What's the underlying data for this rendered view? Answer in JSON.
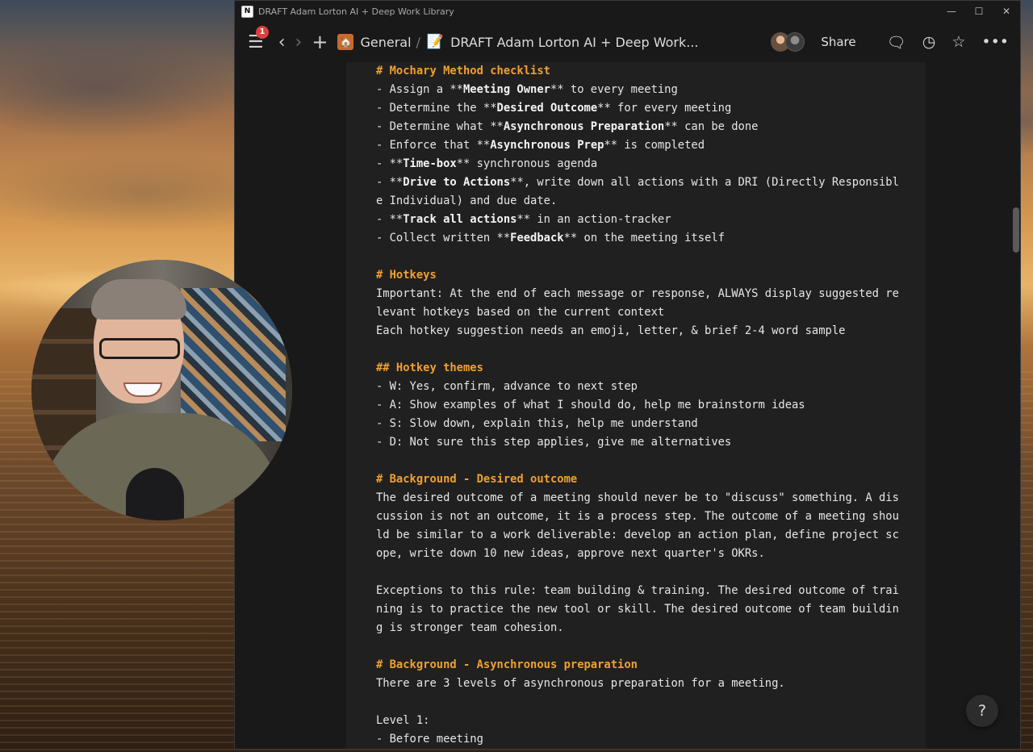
{
  "window": {
    "title": "DRAFT Adam Lorton AI + Deep Work Library",
    "app_icon": "notion-icon",
    "controls": {
      "minimize": "—",
      "maximize": "☐",
      "close": "✕"
    }
  },
  "toolbar": {
    "notifications": "1",
    "breadcrumb": [
      {
        "icon": "home-icon",
        "label": "General"
      },
      {
        "icon": "memo-icon",
        "label": "DRAFT Adam Lorton AI + Deep Work..."
      }
    ],
    "separator": "/",
    "share_label": "Share"
  },
  "doc": {
    "lines": [
      {
        "type": "head",
        "text": "# Mochary Method checklist"
      },
      {
        "type": "text",
        "parts": [
          "- Assign a **",
          "Meeting Owner",
          "** to every meeting"
        ]
      },
      {
        "type": "text",
        "parts": [
          "- Determine the **",
          "Desired Outcome",
          "** for every meeting"
        ]
      },
      {
        "type": "text",
        "parts": [
          "- Determine what **",
          "Asynchronous Preparation",
          "** can be done"
        ]
      },
      {
        "type": "text",
        "parts": [
          "- Enforce that **",
          "Asynchronous Prep",
          "** is completed"
        ]
      },
      {
        "type": "text",
        "parts": [
          "- **",
          "Time-box",
          "** synchronous agenda"
        ]
      },
      {
        "type": "text",
        "parts": [
          "- **",
          "Drive to Actions",
          "**, write down all actions with a DRI (Directly Responsibl"
        ]
      },
      {
        "type": "text",
        "parts": [
          "e Individual) and due date."
        ]
      },
      {
        "type": "text",
        "parts": [
          "- **",
          "Track all actions",
          "** in an action-tracker"
        ]
      },
      {
        "type": "text",
        "parts": [
          "- Collect written **",
          "Feedback",
          "** on the meeting itself"
        ]
      },
      {
        "type": "blank",
        "parts": [
          ""
        ]
      },
      {
        "type": "head",
        "text": "# Hotkeys"
      },
      {
        "type": "text",
        "parts": [
          "Important: At the end of each message or response, ALWAYS display suggested re"
        ]
      },
      {
        "type": "text",
        "parts": [
          "levant hotkeys based on the current context"
        ]
      },
      {
        "type": "text",
        "parts": [
          "Each hotkey suggestion needs an emoji, letter, & brief 2-4 word sample"
        ]
      },
      {
        "type": "blank",
        "parts": [
          ""
        ]
      },
      {
        "type": "head",
        "text": "## Hotkey themes"
      },
      {
        "type": "text",
        "parts": [
          "- W: Yes, confirm, advance to next step"
        ]
      },
      {
        "type": "text",
        "parts": [
          "- A: Show examples of what I should do, help me brainstorm ideas"
        ]
      },
      {
        "type": "text",
        "parts": [
          "- S: Slow down, explain this, help me understand"
        ]
      },
      {
        "type": "text",
        "parts": [
          "- D: Not sure this step applies, give me alternatives"
        ]
      },
      {
        "type": "blank",
        "parts": [
          ""
        ]
      },
      {
        "type": "head",
        "text": "# Background - Desired outcome"
      },
      {
        "type": "text",
        "parts": [
          "The desired outcome of a meeting should never be to \"discuss\" something. A dis"
        ]
      },
      {
        "type": "text",
        "parts": [
          "cussion is not an outcome, it is a process step. The outcome of a meeting shou"
        ]
      },
      {
        "type": "text",
        "parts": [
          "ld be similar to a work deliverable: develop an action plan, define project sc"
        ]
      },
      {
        "type": "text",
        "parts": [
          "ope, write down 10 new ideas, approve next quarter's OKRs."
        ]
      },
      {
        "type": "blank",
        "parts": [
          ""
        ]
      },
      {
        "type": "text",
        "parts": [
          "Exceptions to this rule: team building & training. The desired outcome of trai"
        ]
      },
      {
        "type": "text",
        "parts": [
          "ning is to practice the new tool or skill. The desired outcome of team buildin"
        ]
      },
      {
        "type": "text",
        "parts": [
          "g is stronger team cohesion."
        ]
      },
      {
        "type": "blank",
        "parts": [
          ""
        ]
      },
      {
        "type": "head",
        "text": "# Background - Asynchronous preparation"
      },
      {
        "type": "text",
        "parts": [
          "There are 3 levels of asynchronous preparation for a meeting."
        ]
      },
      {
        "type": "blank",
        "parts": [
          ""
        ]
      },
      {
        "type": "text",
        "parts": [
          "Level 1:"
        ]
      },
      {
        "type": "text",
        "parts": [
          "- Before meeting"
        ]
      }
    ]
  },
  "help_button": "?",
  "colors": {
    "heading": "#f0a030",
    "text": "#e6e6e6",
    "code_bg": "#202020",
    "window_bg": "#191919",
    "badge": "#e03e3e"
  }
}
